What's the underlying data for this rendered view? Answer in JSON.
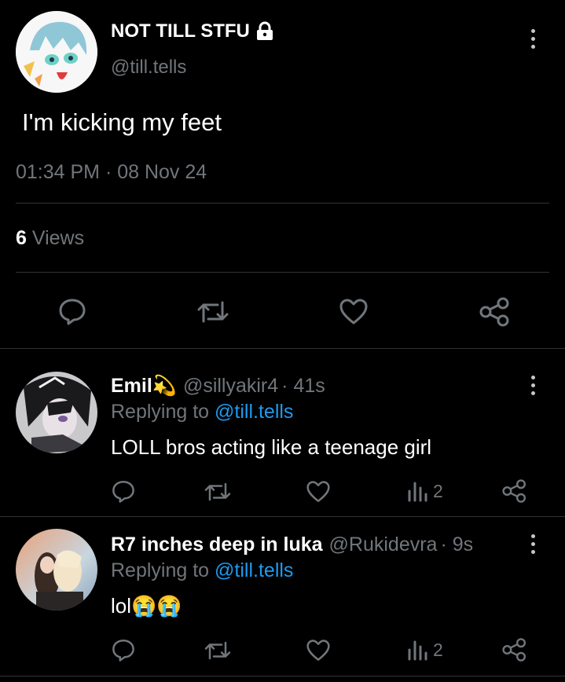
{
  "main_tweet": {
    "display_name": "NOT TILL STFU",
    "handle": "@till.tells",
    "text": "I'm kicking my feet",
    "timestamp": "01:34 PM · 08 Nov 24",
    "views_count": "6",
    "views_label": "Views"
  },
  "replies": [
    {
      "display_name": "Emil💫",
      "handle": "@sillyakir4",
      "time": "· 41s",
      "replying_prefix": "Replying to",
      "replying_to": "@till.tells",
      "text": "LOLL bros acting like a teenage girl",
      "views": "2"
    },
    {
      "display_name": "R7 inches deep in luka",
      "handle": "@Rukidevra",
      "time": "· 9s",
      "replying_prefix": "Replying to",
      "replying_to": "@till.tells",
      "text": "lol😭😭",
      "views": "2"
    }
  ],
  "icons": {
    "lock": "lock-icon",
    "more": "more-icon",
    "reply": "reply-icon",
    "retweet": "retweet-icon",
    "like": "heart-icon",
    "share": "share-icon",
    "views": "views-icon"
  },
  "colors": {
    "background": "#000000",
    "text": "#e7e9ea",
    "muted": "#71767b",
    "link": "#1d9bf0",
    "divider": "#2f3336"
  }
}
